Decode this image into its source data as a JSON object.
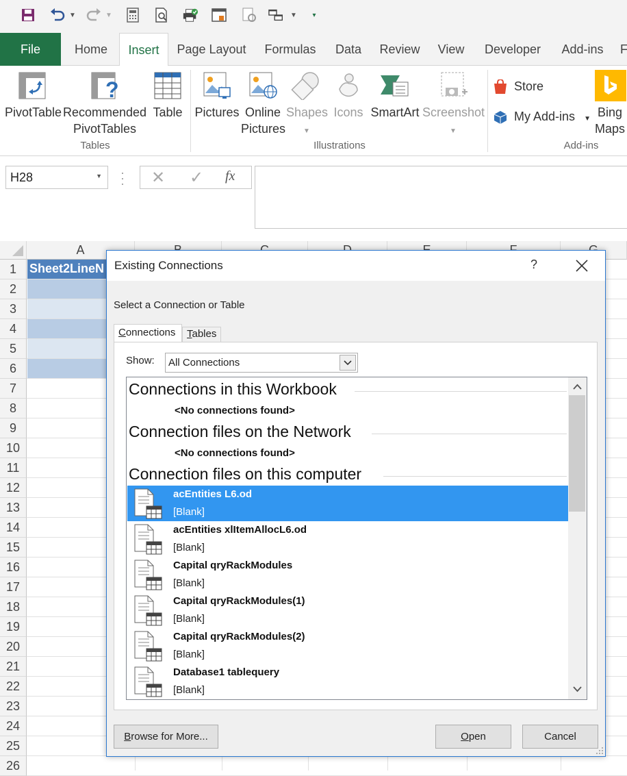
{
  "quick_access": {
    "icons": [
      "save-icon",
      "undo-icon",
      "redo-icon",
      "calculator-icon",
      "print-preview-icon",
      "quick-print-icon",
      "page-setup-icon",
      "refresh-icon",
      "arrange-icon",
      "customize-icon"
    ]
  },
  "ribbon_tabs": [
    "File",
    "Home",
    "Insert",
    "Page Layout",
    "Formulas",
    "Data",
    "Review",
    "View",
    "Developer",
    "Add-ins",
    "F"
  ],
  "active_tab": "Insert",
  "ribbon": {
    "tables": {
      "label": "Tables",
      "pivottable": "PivotTable",
      "recommended_line1": "Recommended",
      "recommended_line2": "PivotTables",
      "table": "Table"
    },
    "illustrations": {
      "label": "Illustrations",
      "pictures": "Pictures",
      "online_line1": "Online",
      "online_line2": "Pictures",
      "shapes": "Shapes",
      "icons": "Icons",
      "smartart": "SmartArt",
      "screenshot": "Screenshot"
    },
    "addins": {
      "label": "Add-ins",
      "store": "Store",
      "my_addins": "My Add-ins",
      "bing_line1": "Bing",
      "bing_line2": "Maps"
    }
  },
  "formula_bar": {
    "name_box": "H28",
    "fx": "fx"
  },
  "sheet": {
    "columns": [
      "A",
      "B",
      "C",
      "D",
      "E",
      "F",
      "G"
    ],
    "rows": [
      "1",
      "2",
      "3",
      "4",
      "5",
      "6",
      "7",
      "8",
      "9",
      "10",
      "11",
      "12",
      "13",
      "14",
      "15",
      "16",
      "17",
      "18",
      "19",
      "20",
      "21",
      "22",
      "23",
      "24",
      "25",
      "26"
    ],
    "a1_value": "Sheet2LineN"
  },
  "dialog": {
    "title": "Existing Connections",
    "help": "?",
    "prompt": "Select a Connection or Table",
    "tabs": {
      "connections_prefix": "C",
      "connections_rest": "onnections",
      "tables_prefix": "T",
      "tables_rest": "ables"
    },
    "show_label": "Show:",
    "show_value": "All Connections",
    "groups": [
      {
        "title": "Connections in this Workbook",
        "empty": "<No connections found>"
      },
      {
        "title": "Connection files on the Network",
        "empty": "<No connections found>"
      },
      {
        "title": "Connection files on this computer"
      }
    ],
    "items": [
      {
        "name": "acEntities L6.od",
        "desc": "[Blank]",
        "selected": true
      },
      {
        "name": "acEntities xlItemAllocL6.od",
        "desc": "[Blank]"
      },
      {
        "name": "Capital qryRackModules",
        "desc": "[Blank]"
      },
      {
        "name": "Capital qryRackModules(1)",
        "desc": "[Blank]"
      },
      {
        "name": "Capital qryRackModules(2)",
        "desc": "[Blank]"
      },
      {
        "name": "Database1 tablequery",
        "desc": "[Blank]"
      }
    ],
    "buttons": {
      "browse_prefix": "B",
      "browse_rest": "rowse for More...",
      "open_prefix": "O",
      "open_rest": "pen",
      "cancel": "Cancel"
    }
  },
  "colors": {
    "excel_green": "#217346",
    "selection_blue": "#3296f0",
    "table_band_dark": "#b8cce4",
    "table_band_light": "#dce6f1",
    "table_header": "#4f81bd"
  }
}
